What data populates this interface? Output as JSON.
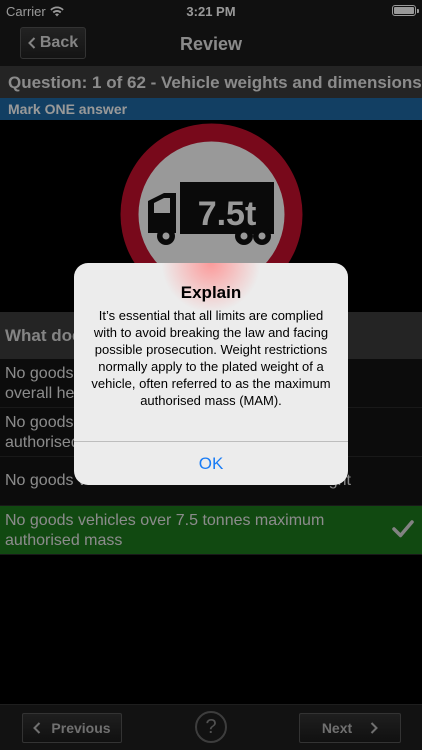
{
  "status_bar": {
    "carrier": "Carrier",
    "time": "3:21 PM"
  },
  "nav": {
    "back_label": "Back",
    "title": "Review"
  },
  "question": {
    "header": "Question: 1 of 62 - Vehicle weights and dimensions",
    "instruction": "Mark ONE answer",
    "text": "What does this sign mean?",
    "sign_text": "7.5t"
  },
  "answers": [
    {
      "line1": "No goods vehicles over 7.5 tonnes",
      "line2": "overall height",
      "correct": false
    },
    {
      "line1": "No goods vehicles over 7.5 tonnes maximum",
      "line2": "authorised width",
      "correct": false
    },
    {
      "line1": "No goods vehicles over 7.5 metres overall height",
      "line2": "",
      "correct": false
    },
    {
      "line1": "No goods vehicles over 7.5 tonnes maximum",
      "line2": "authorised mass",
      "correct": true
    }
  ],
  "toolbar": {
    "previous_label": "Previous",
    "help_label": "?",
    "next_label": "Next"
  },
  "alert": {
    "title": "Explain",
    "message": "It’s essential that all limits are complied with to avoid breaking the law and facing possible prosecution. Weight restrictions normally apply to the plated weight of a vehicle, often referred to as the maximum authorised mass (MAM).",
    "ok_label": "OK"
  },
  "colors": {
    "accent_blue": "#1e6aa5",
    "correct_green": "#1d7a1d",
    "sign_red": "#c8102e",
    "ios_blue": "#1a7cf5"
  }
}
